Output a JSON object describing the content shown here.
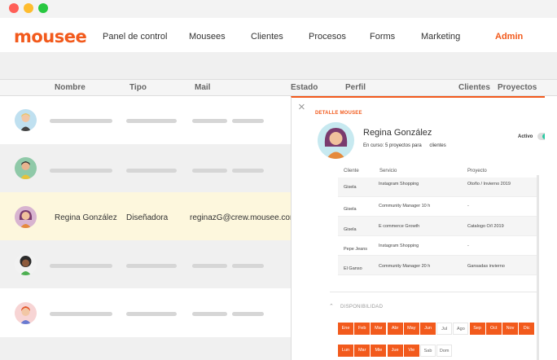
{
  "nav": {
    "logo": "mousee",
    "items": [
      "Panel de control",
      "Mousees",
      "Clientes",
      "Procesos",
      "Forms",
      "Marketing"
    ],
    "admin": "Admin"
  },
  "table": {
    "headers": {
      "nombre": "Nombre",
      "tipo": "Tipo",
      "mail": "Mail",
      "estado": "Estado",
      "perfil": "Perfil",
      "clientes": "Clientes",
      "proyectos": "Proyectos"
    },
    "selected_row": {
      "nombre": "Regina González",
      "tipo": "Diseñadora",
      "mail": "reginazG@crew.mousee.com"
    }
  },
  "detail": {
    "close": "×",
    "label": "DETALLE MOUSEE",
    "name": "Regina González",
    "sub_prefix": "En curso: 5 proyectos para",
    "sub_suffix": "clientes",
    "status": "Activo",
    "columns": [
      "Cliente",
      "Servicio",
      "Proyecto"
    ],
    "rows": [
      {
        "cliente": "Gisela",
        "servicio": "Instagram Shopping",
        "proyecto": "Otoño / Invierno 2019"
      },
      {
        "cliente": "Gisela",
        "servicio": "Community Manager 10 h",
        "proyecto": "-"
      },
      {
        "cliente": "Gisela",
        "servicio": "E commerce Growth",
        "proyecto": "Catalogo O/I 2019"
      },
      {
        "cliente": "Pepe Jeans",
        "servicio": "Instagram Shopping",
        "proyecto": "-"
      },
      {
        "cliente": "El Ganso",
        "servicio": "Community Manager 20 h",
        "proyecto": "Gansadas invierno"
      }
    ],
    "availability_title": "DISPONIBILIDAD",
    "months": [
      {
        "label": "Ene",
        "on": true
      },
      {
        "label": "Feb",
        "on": true
      },
      {
        "label": "Mar",
        "on": true
      },
      {
        "label": "Abr",
        "on": true
      },
      {
        "label": "May",
        "on": true
      },
      {
        "label": "Jun",
        "on": true
      },
      {
        "label": "Jul",
        "on": false
      },
      {
        "label": "Ago",
        "on": false
      },
      {
        "label": "Sep",
        "on": true
      },
      {
        "label": "Oct",
        "on": true
      },
      {
        "label": "Nov",
        "on": true
      },
      {
        "label": "Dic",
        "on": true
      }
    ],
    "days": [
      {
        "label": "Lun",
        "on": true
      },
      {
        "label": "Mar",
        "on": true
      },
      {
        "label": "Mie",
        "on": true
      },
      {
        "label": "Jue",
        "on": true
      },
      {
        "label": "Vie",
        "on": true
      },
      {
        "label": "Sab",
        "on": false
      },
      {
        "label": "Dom",
        "on": false
      }
    ]
  },
  "colors": {
    "brand": "#f25a1c",
    "selected_row": "#fdf7dd",
    "toggle_on": "#2cc9a3"
  }
}
